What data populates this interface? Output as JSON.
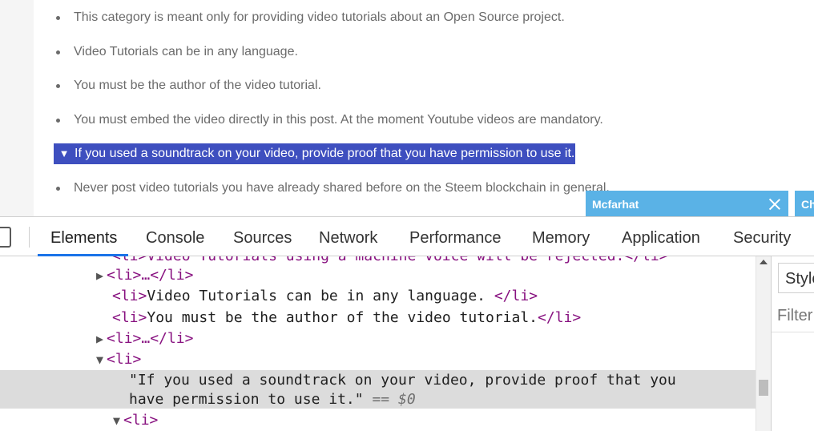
{
  "page": {
    "rules": [
      {
        "text": "This category is meant only for providing video tutorials about an Open Source project.",
        "selected": false
      },
      {
        "text": "Video Tutorials can be in any language.",
        "selected": false
      },
      {
        "text": "You must be the author of the video tutorial.",
        "selected": false
      },
      {
        "text": "You must embed the video directly in this post. At the moment Youtube videos are mandatory.",
        "selected": false
      },
      {
        "text": "If you used a soundtrack on your video, provide proof that you have permission to use it.",
        "selected": true
      },
      {
        "text": "Never post video tutorials you have already shared before on the Steem blockchain in general.",
        "selected": false
      }
    ],
    "chat": {
      "name": "Mcfarhat",
      "second_label": "Ch"
    }
  },
  "devtools": {
    "tabs": [
      "Elements",
      "Console",
      "Sources",
      "Network",
      "Performance",
      "Memory",
      "Application",
      "Security"
    ],
    "active_tab": "Elements",
    "dom": {
      "clipped_line": "<li>Video Tutorials using a machine voice will be rejected.</li>",
      "collapsed": "<li>…</li>",
      "line_language": "Video Tutorials can be in any language. ",
      "line_author": "You must be the author of the video tutorial.",
      "li_open": "<li>",
      "li_close": "</li>",
      "selected_text_1": "\"If you used a soundtrack on your video, provide proof that you",
      "selected_text_2": "have permission to use it.\"",
      "eq": "==",
      "dollar": "$0"
    },
    "styles": {
      "tab_label": "Styles",
      "filter_placeholder": "Filter"
    }
  },
  "colors": {
    "selection": "#3e4fbf",
    "chat_bar": "#5ab2e6",
    "active_tab_underline": "#1a73e8",
    "tag": "#881280"
  }
}
